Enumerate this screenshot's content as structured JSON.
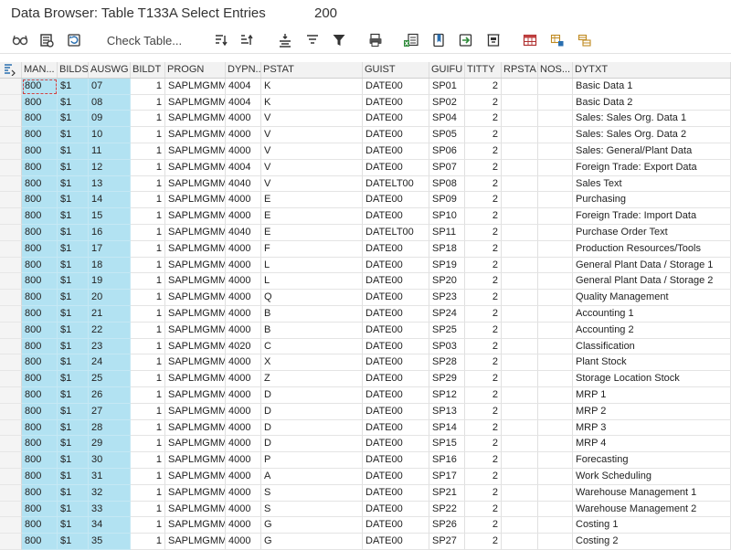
{
  "window": {
    "title": "Data Browser: Table T133A Select Entries",
    "entry_count": "200"
  },
  "toolbar": {
    "check_table_label": "Check Table..."
  },
  "columns": [
    "MAN...",
    "BILDS",
    "AUSWG",
    "BILDT",
    "PROGN",
    "DYPN...",
    "PSTAT",
    "GUIST",
    "GUIFU",
    "TITTY",
    "RPSTA",
    "NOS...",
    "DYTXT"
  ],
  "rows": [
    {
      "mandt": "800",
      "bilds": "$1",
      "auswg": "07",
      "bildt": "1",
      "progn": "SAPLMGMM",
      "dypno": "4004",
      "pstat": "K",
      "guist": "DATE00",
      "guifu": "SP01",
      "titty": "2",
      "rpsta": "",
      "nos": "",
      "dytxt": "Basic Data 1"
    },
    {
      "mandt": "800",
      "bilds": "$1",
      "auswg": "08",
      "bildt": "1",
      "progn": "SAPLMGMM",
      "dypno": "4004",
      "pstat": "K",
      "guist": "DATE00",
      "guifu": "SP02",
      "titty": "2",
      "rpsta": "",
      "nos": "",
      "dytxt": "Basic Data 2"
    },
    {
      "mandt": "800",
      "bilds": "$1",
      "auswg": "09",
      "bildt": "1",
      "progn": "SAPLMGMM",
      "dypno": "4000",
      "pstat": "V",
      "guist": "DATE00",
      "guifu": "SP04",
      "titty": "2",
      "rpsta": "",
      "nos": "",
      "dytxt": "Sales: Sales Org. Data 1"
    },
    {
      "mandt": "800",
      "bilds": "$1",
      "auswg": "10",
      "bildt": "1",
      "progn": "SAPLMGMM",
      "dypno": "4000",
      "pstat": "V",
      "guist": "DATE00",
      "guifu": "SP05",
      "titty": "2",
      "rpsta": "",
      "nos": "",
      "dytxt": "Sales: Sales Org. Data 2"
    },
    {
      "mandt": "800",
      "bilds": "$1",
      "auswg": "11",
      "bildt": "1",
      "progn": "SAPLMGMM",
      "dypno": "4000",
      "pstat": "V",
      "guist": "DATE00",
      "guifu": "SP06",
      "titty": "2",
      "rpsta": "",
      "nos": "",
      "dytxt": "Sales: General/Plant Data"
    },
    {
      "mandt": "800",
      "bilds": "$1",
      "auswg": "12",
      "bildt": "1",
      "progn": "SAPLMGMM",
      "dypno": "4004",
      "pstat": "V",
      "guist": "DATE00",
      "guifu": "SP07",
      "titty": "2",
      "rpsta": "",
      "nos": "",
      "dytxt": "Foreign Trade: Export Data"
    },
    {
      "mandt": "800",
      "bilds": "$1",
      "auswg": "13",
      "bildt": "1",
      "progn": "SAPLMGMM",
      "dypno": "4040",
      "pstat": "V",
      "guist": "DATELT00",
      "guifu": "SP08",
      "titty": "2",
      "rpsta": "",
      "nos": "",
      "dytxt": "Sales Text"
    },
    {
      "mandt": "800",
      "bilds": "$1",
      "auswg": "14",
      "bildt": "1",
      "progn": "SAPLMGMM",
      "dypno": "4000",
      "pstat": "E",
      "guist": "DATE00",
      "guifu": "SP09",
      "titty": "2",
      "rpsta": "",
      "nos": "",
      "dytxt": "Purchasing"
    },
    {
      "mandt": "800",
      "bilds": "$1",
      "auswg": "15",
      "bildt": "1",
      "progn": "SAPLMGMM",
      "dypno": "4000",
      "pstat": "E",
      "guist": "DATE00",
      "guifu": "SP10",
      "titty": "2",
      "rpsta": "",
      "nos": "",
      "dytxt": "Foreign Trade: Import Data"
    },
    {
      "mandt": "800",
      "bilds": "$1",
      "auswg": "16",
      "bildt": "1",
      "progn": "SAPLMGMM",
      "dypno": "4040",
      "pstat": "E",
      "guist": "DATELT00",
      "guifu": "SP11",
      "titty": "2",
      "rpsta": "",
      "nos": "",
      "dytxt": "Purchase Order Text"
    },
    {
      "mandt": "800",
      "bilds": "$1",
      "auswg": "17",
      "bildt": "1",
      "progn": "SAPLMGMM",
      "dypno": "4000",
      "pstat": "F",
      "guist": "DATE00",
      "guifu": "SP18",
      "titty": "2",
      "rpsta": "",
      "nos": "",
      "dytxt": "Production Resources/Tools"
    },
    {
      "mandt": "800",
      "bilds": "$1",
      "auswg": "18",
      "bildt": "1",
      "progn": "SAPLMGMM",
      "dypno": "4000",
      "pstat": "L",
      "guist": "DATE00",
      "guifu": "SP19",
      "titty": "2",
      "rpsta": "",
      "nos": "",
      "dytxt": "General Plant Data / Storage 1"
    },
    {
      "mandt": "800",
      "bilds": "$1",
      "auswg": "19",
      "bildt": "1",
      "progn": "SAPLMGMM",
      "dypno": "4000",
      "pstat": "L",
      "guist": "DATE00",
      "guifu": "SP20",
      "titty": "2",
      "rpsta": "",
      "nos": "",
      "dytxt": "General Plant Data / Storage 2"
    },
    {
      "mandt": "800",
      "bilds": "$1",
      "auswg": "20",
      "bildt": "1",
      "progn": "SAPLMGMM",
      "dypno": "4000",
      "pstat": "Q",
      "guist": "DATE00",
      "guifu": "SP23",
      "titty": "2",
      "rpsta": "",
      "nos": "",
      "dytxt": "Quality Management"
    },
    {
      "mandt": "800",
      "bilds": "$1",
      "auswg": "21",
      "bildt": "1",
      "progn": "SAPLMGMM",
      "dypno": "4000",
      "pstat": "B",
      "guist": "DATE00",
      "guifu": "SP24",
      "titty": "2",
      "rpsta": "",
      "nos": "",
      "dytxt": "Accounting 1"
    },
    {
      "mandt": "800",
      "bilds": "$1",
      "auswg": "22",
      "bildt": "1",
      "progn": "SAPLMGMM",
      "dypno": "4000",
      "pstat": "B",
      "guist": "DATE00",
      "guifu": "SP25",
      "titty": "2",
      "rpsta": "",
      "nos": "",
      "dytxt": "Accounting 2"
    },
    {
      "mandt": "800",
      "bilds": "$1",
      "auswg": "23",
      "bildt": "1",
      "progn": "SAPLMGMM",
      "dypno": "4020",
      "pstat": "C",
      "guist": "DATE00",
      "guifu": "SP03",
      "titty": "2",
      "rpsta": "",
      "nos": "",
      "dytxt": "Classification"
    },
    {
      "mandt": "800",
      "bilds": "$1",
      "auswg": "24",
      "bildt": "1",
      "progn": "SAPLMGMM",
      "dypno": "4000",
      "pstat": "X",
      "guist": "DATE00",
      "guifu": "SP28",
      "titty": "2",
      "rpsta": "",
      "nos": "",
      "dytxt": "Plant Stock"
    },
    {
      "mandt": "800",
      "bilds": "$1",
      "auswg": "25",
      "bildt": "1",
      "progn": "SAPLMGMM",
      "dypno": "4000",
      "pstat": "Z",
      "guist": "DATE00",
      "guifu": "SP29",
      "titty": "2",
      "rpsta": "",
      "nos": "",
      "dytxt": "Storage Location Stock"
    },
    {
      "mandt": "800",
      "bilds": "$1",
      "auswg": "26",
      "bildt": "1",
      "progn": "SAPLMGMM",
      "dypno": "4000",
      "pstat": "D",
      "guist": "DATE00",
      "guifu": "SP12",
      "titty": "2",
      "rpsta": "",
      "nos": "",
      "dytxt": "MRP 1"
    },
    {
      "mandt": "800",
      "bilds": "$1",
      "auswg": "27",
      "bildt": "1",
      "progn": "SAPLMGMM",
      "dypno": "4000",
      "pstat": "D",
      "guist": "DATE00",
      "guifu": "SP13",
      "titty": "2",
      "rpsta": "",
      "nos": "",
      "dytxt": "MRP 2"
    },
    {
      "mandt": "800",
      "bilds": "$1",
      "auswg": "28",
      "bildt": "1",
      "progn": "SAPLMGMM",
      "dypno": "4000",
      "pstat": "D",
      "guist": "DATE00",
      "guifu": "SP14",
      "titty": "2",
      "rpsta": "",
      "nos": "",
      "dytxt": "MRP 3"
    },
    {
      "mandt": "800",
      "bilds": "$1",
      "auswg": "29",
      "bildt": "1",
      "progn": "SAPLMGMM",
      "dypno": "4000",
      "pstat": "D",
      "guist": "DATE00",
      "guifu": "SP15",
      "titty": "2",
      "rpsta": "",
      "nos": "",
      "dytxt": "MRP 4"
    },
    {
      "mandt": "800",
      "bilds": "$1",
      "auswg": "30",
      "bildt": "1",
      "progn": "SAPLMGMM",
      "dypno": "4000",
      "pstat": "P",
      "guist": "DATE00",
      "guifu": "SP16",
      "titty": "2",
      "rpsta": "",
      "nos": "",
      "dytxt": "Forecasting"
    },
    {
      "mandt": "800",
      "bilds": "$1",
      "auswg": "31",
      "bildt": "1",
      "progn": "SAPLMGMM",
      "dypno": "4000",
      "pstat": "A",
      "guist": "DATE00",
      "guifu": "SP17",
      "titty": "2",
      "rpsta": "",
      "nos": "",
      "dytxt": "Work Scheduling"
    },
    {
      "mandt": "800",
      "bilds": "$1",
      "auswg": "32",
      "bildt": "1",
      "progn": "SAPLMGMM",
      "dypno": "4000",
      "pstat": "S",
      "guist": "DATE00",
      "guifu": "SP21",
      "titty": "2",
      "rpsta": "",
      "nos": "",
      "dytxt": "Warehouse Management 1"
    },
    {
      "mandt": "800",
      "bilds": "$1",
      "auswg": "33",
      "bildt": "1",
      "progn": "SAPLMGMM",
      "dypno": "4000",
      "pstat": "S",
      "guist": "DATE00",
      "guifu": "SP22",
      "titty": "2",
      "rpsta": "",
      "nos": "",
      "dytxt": "Warehouse Management 2"
    },
    {
      "mandt": "800",
      "bilds": "$1",
      "auswg": "34",
      "bildt": "1",
      "progn": "SAPLMGMM",
      "dypno": "4000",
      "pstat": "G",
      "guist": "DATE00",
      "guifu": "SP26",
      "titty": "2",
      "rpsta": "",
      "nos": "",
      "dytxt": "Costing 1"
    },
    {
      "mandt": "800",
      "bilds": "$1",
      "auswg": "35",
      "bildt": "1",
      "progn": "SAPLMGMM",
      "dypno": "4000",
      "pstat": "G",
      "guist": "DATE00",
      "guifu": "SP27",
      "titty": "2",
      "rpsta": "",
      "nos": "",
      "dytxt": "Costing 2"
    }
  ],
  "colors": {
    "key_column": "#b2e2f2",
    "header": "#f2f2f2",
    "focus": "#d04040"
  },
  "icons": [
    "glasses-icon",
    "details-icon",
    "refresh-icon",
    "sort-ascending-icon",
    "sort-descending-icon",
    "align-center-icon",
    "align-justify-icon",
    "filter-icon",
    "print-preview-icon",
    "export-excel-icon",
    "bookmark-icon",
    "export-icon",
    "layout-icon",
    "table-view-icon",
    "fields-icon",
    "config-icon"
  ]
}
